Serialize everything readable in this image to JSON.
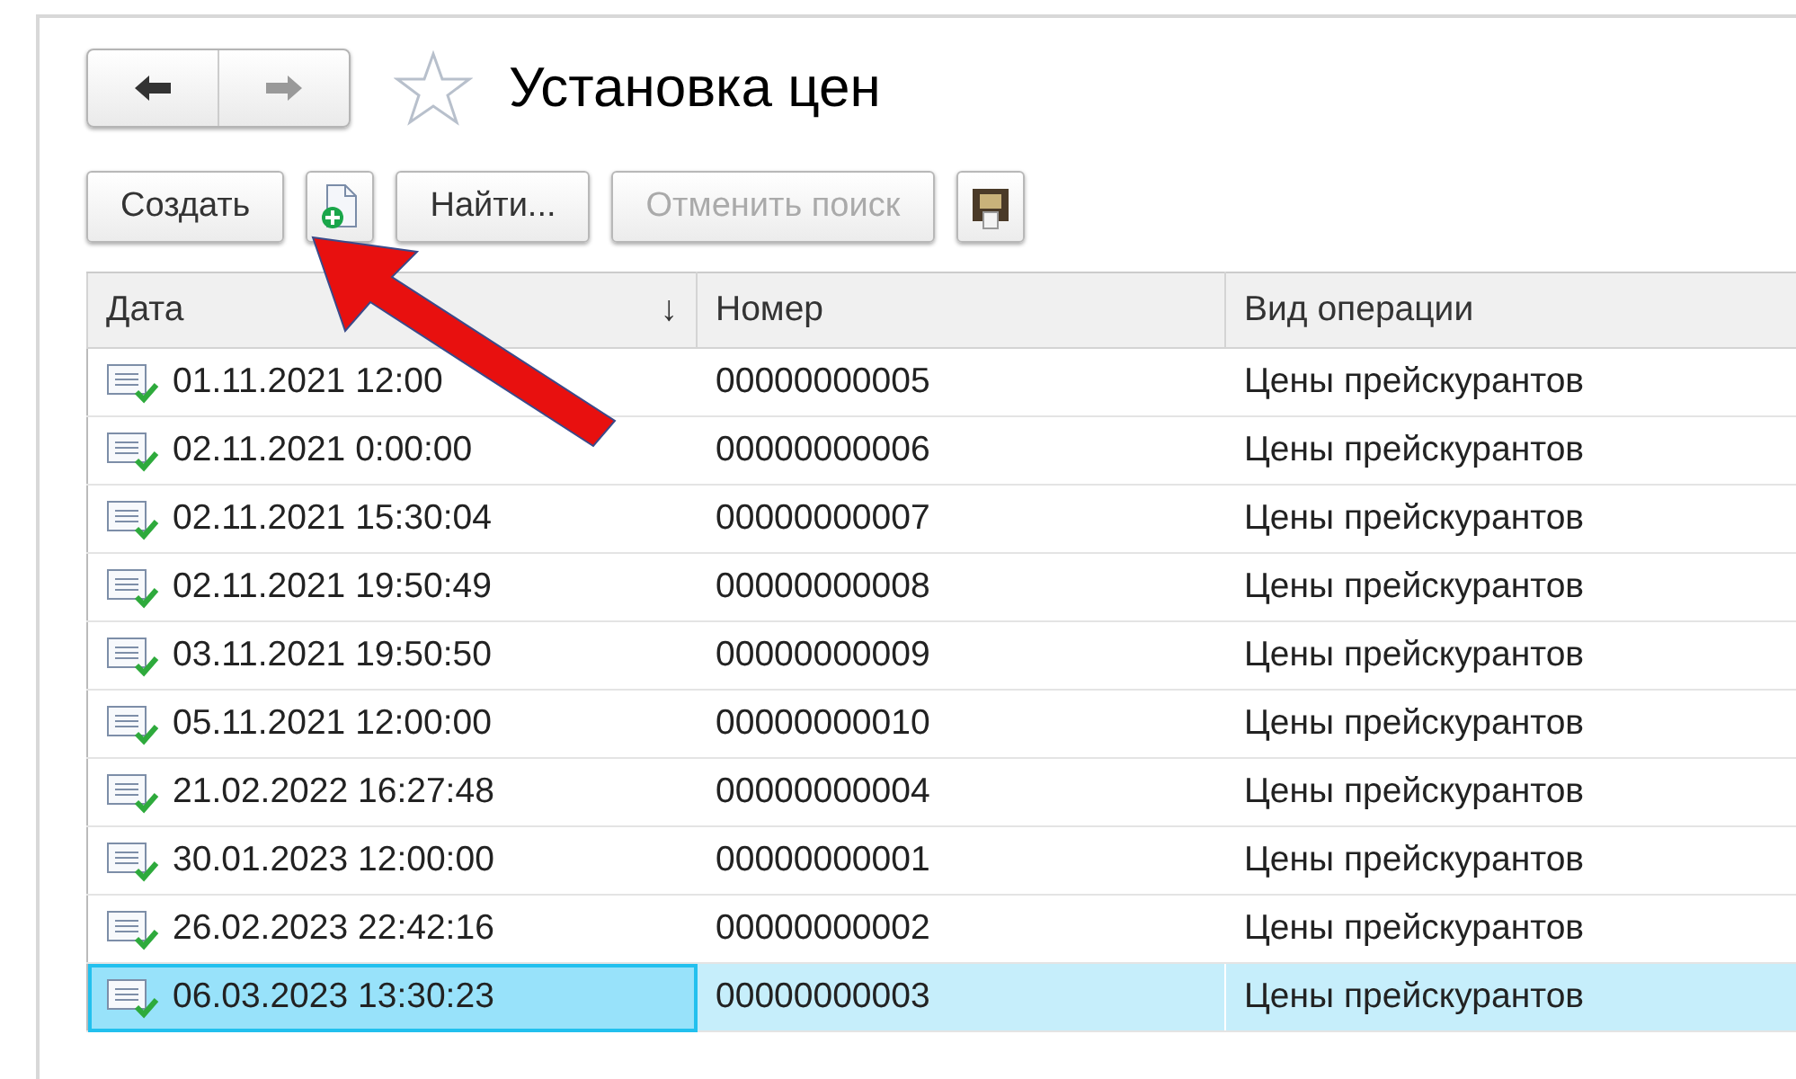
{
  "window": {
    "title": "Установка цен",
    "favorite": false
  },
  "toolbar": [
    {
      "kind": "text",
      "label": "Создать",
      "disabled": false
    },
    {
      "kind": "add"
    },
    {
      "kind": "text",
      "label": "Найти...",
      "disabled": false
    },
    {
      "kind": "text",
      "label": "Отменить поиск",
      "disabled": true
    },
    {
      "kind": "printer"
    }
  ],
  "table": {
    "columns": [
      {
        "label": "Дата",
        "sort": "↓"
      },
      {
        "label": "Номер"
      },
      {
        "label": "Вид операции"
      }
    ],
    "rows": [
      {
        "cells": [
          "01.11.2021 12:00",
          "00000000005",
          "Цены прейскурантов"
        ],
        "selected": false
      },
      {
        "cells": [
          "02.11.2021 0:00:00",
          "00000000006",
          "Цены прейскурантов"
        ],
        "selected": false
      },
      {
        "cells": [
          "02.11.2021 15:30:04",
          "00000000007",
          "Цены прейскурантов"
        ],
        "selected": false
      },
      {
        "cells": [
          "02.11.2021 19:50:49",
          "00000000008",
          "Цены прейскурантов"
        ],
        "selected": false
      },
      {
        "cells": [
          "03.11.2021 19:50:50",
          "00000000009",
          "Цены прейскурантов"
        ],
        "selected": false
      },
      {
        "cells": [
          "05.11.2021 12:00:00",
          "00000000010",
          "Цены прейскурантов"
        ],
        "selected": false
      },
      {
        "cells": [
          "21.02.2022 16:27:48",
          "00000000004",
          "Цены прейскурантов"
        ],
        "selected": false
      },
      {
        "cells": [
          "30.01.2023 12:00:00",
          "00000000001",
          "Цены прейскурантов"
        ],
        "selected": false
      },
      {
        "cells": [
          "26.02.2023 22:42:16",
          "00000000002",
          "Цены прейскурантов"
        ],
        "selected": false
      },
      {
        "cells": [
          "06.03.2023 13:30:23",
          "00000000003",
          "Цены прейскурантов"
        ],
        "selected": true
      }
    ]
  }
}
